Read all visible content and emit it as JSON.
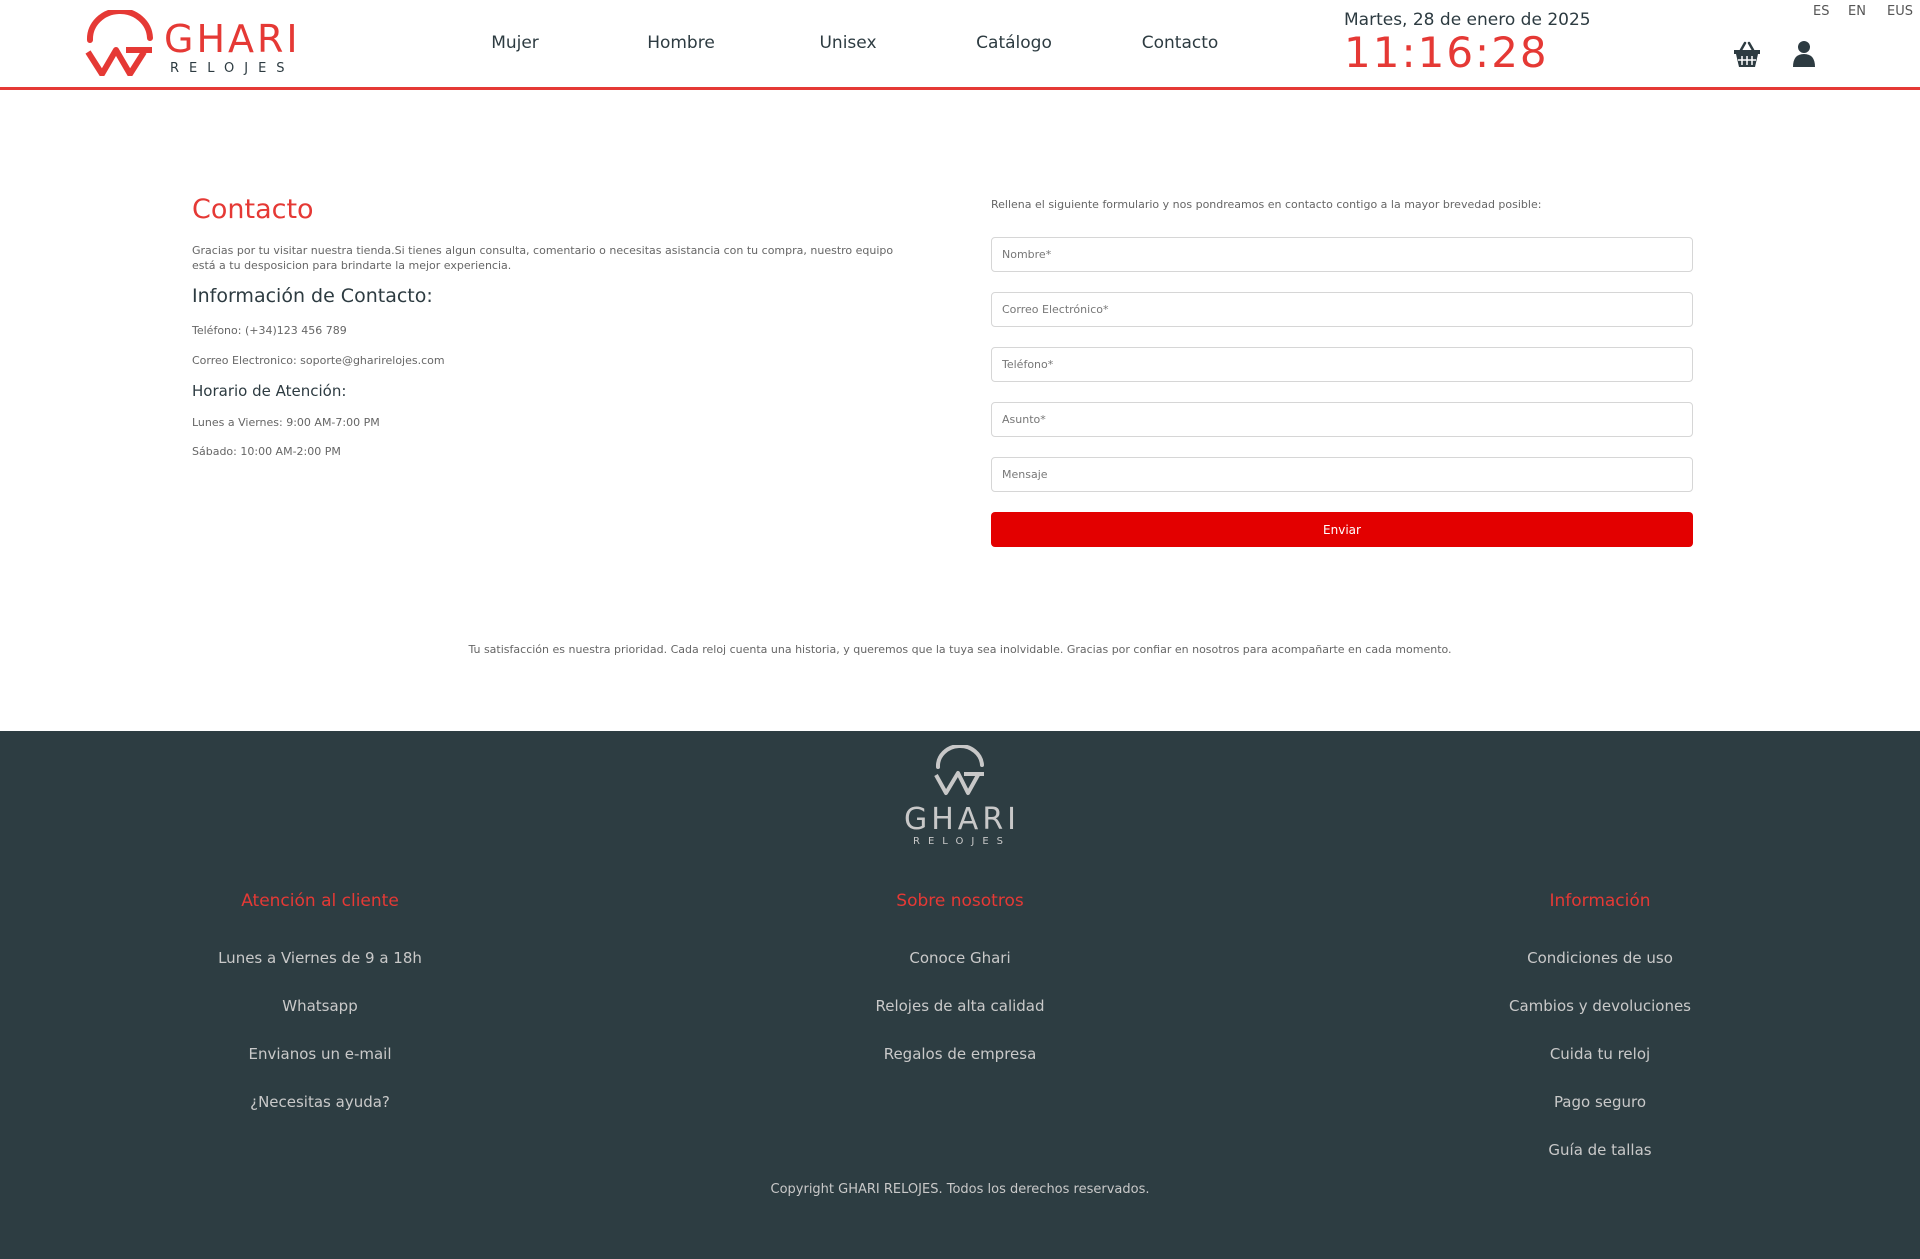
{
  "header": {
    "logo_name": "GHARI",
    "logo_sub": "RELOJES",
    "nav": [
      "Mujer",
      "Hombre",
      "Unisex",
      "Catálogo",
      "Contacto"
    ],
    "date": "Martes, 28 de enero de 2025",
    "time": "11:16:28",
    "languages": [
      "ES",
      "EN",
      "EUS"
    ],
    "icons": {
      "cart": "basket-icon",
      "user": "user-icon"
    },
    "accent_color": "#e53935"
  },
  "contact": {
    "title": "Contacto",
    "intro": "Gracias por tu visitar nuestra tienda.Si tienes algun consulta, comentario o necesitas asistancia con tu compra, nuestro equipo está a tu desposicion para brindarte la mejor experiencia.",
    "info_heading": "Información de Contacto:",
    "phone": "Teléfono: (+34)123 456 789",
    "email": "Correo Electronico: soporte@gharirelojes.com",
    "hours_heading": "Horario de Atención:",
    "weekdays": "Lunes a Viernes: 9:00 AM-7:00 PM",
    "saturday": "Sábado: 10:00 AM-2:00 PM"
  },
  "form": {
    "intro": "Rellena el siguiente formulario y nos pondreamos en contacto contigo a la mayor brevedad posible:",
    "placeholders": {
      "name": "Nombre*",
      "email": "Correo Electrónico*",
      "phone": "Teléfono*",
      "subject": "Asunto*",
      "message": "Mensaje"
    },
    "submit": "Enviar",
    "button_color": "#e30000"
  },
  "satisfaction": "Tu satisfacción es nuestra prioridad. Cada reloj cuenta una historia, y queremos que la tuya sea inolvidable. Gracias por confiar en nosotros para acompañarte en cada momento.",
  "footer": {
    "background": "#2d3d42",
    "logo_name": "GHARI",
    "logo_sub": "RELOJES",
    "columns": [
      {
        "heading": "Atención al cliente",
        "links": [
          "Lunes a Viernes de 9 a 18h",
          "Whatsapp",
          "Envianos un e-mail",
          "¿Necesitas ayuda?"
        ]
      },
      {
        "heading": "Sobre nosotros",
        "links": [
          "Conoce Ghari",
          "Relojes de alta calidad",
          "Regalos de empresa"
        ]
      },
      {
        "heading": "Información",
        "links": [
          "Condiciones de uso",
          "Cambios y devoluciones",
          "Cuida tu reloj",
          "Pago seguro",
          "Guía de tallas"
        ]
      }
    ],
    "copyright": "Copyright GHARI RELOJES. Todos los derechos reservados."
  }
}
